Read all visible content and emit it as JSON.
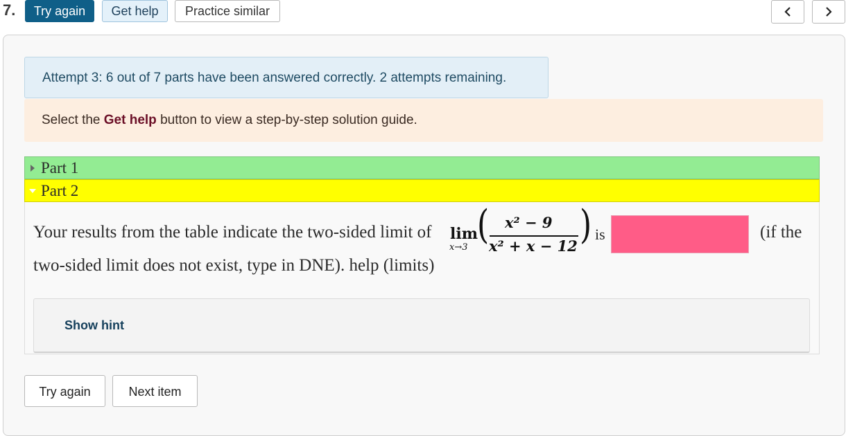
{
  "question": {
    "number": "7."
  },
  "toolbar": {
    "try_again": "Try again",
    "get_help": "Get help",
    "practice_similar": "Practice similar",
    "prev_icon": "chevron-left-icon",
    "next_icon": "chevron-right-icon"
  },
  "alerts": {
    "attempt_status": "Attempt 3: 6 out of 7 parts have been answered correctly. 2 attempts remaining.",
    "help_prefix": "Select the ",
    "help_bold": "Get help",
    "help_suffix": " button to view a step-by-step solution guide."
  },
  "parts": [
    {
      "label": "Part 1",
      "state": "collapsed",
      "color": "#93ec93"
    },
    {
      "label": "Part 2",
      "state": "expanded",
      "color": "#ffff00"
    }
  ],
  "part2": {
    "text_before": "Your results from the table indicate the two-sided limit of",
    "lim_word": "lim",
    "lim_sub": "x→3",
    "numerator": "x² − 9",
    "denominator": "x² + x − 12",
    "is_word": "is",
    "answer_value": "",
    "answer_status_color": "#ff5c87",
    "text_after": "(if the",
    "line2_prefix": "two-sided limit does not exist, type in DNE). ",
    "help_link": "help (limits)",
    "show_hint": "Show hint"
  },
  "footer": {
    "try_again": "Try again",
    "next_item": "Next item"
  }
}
